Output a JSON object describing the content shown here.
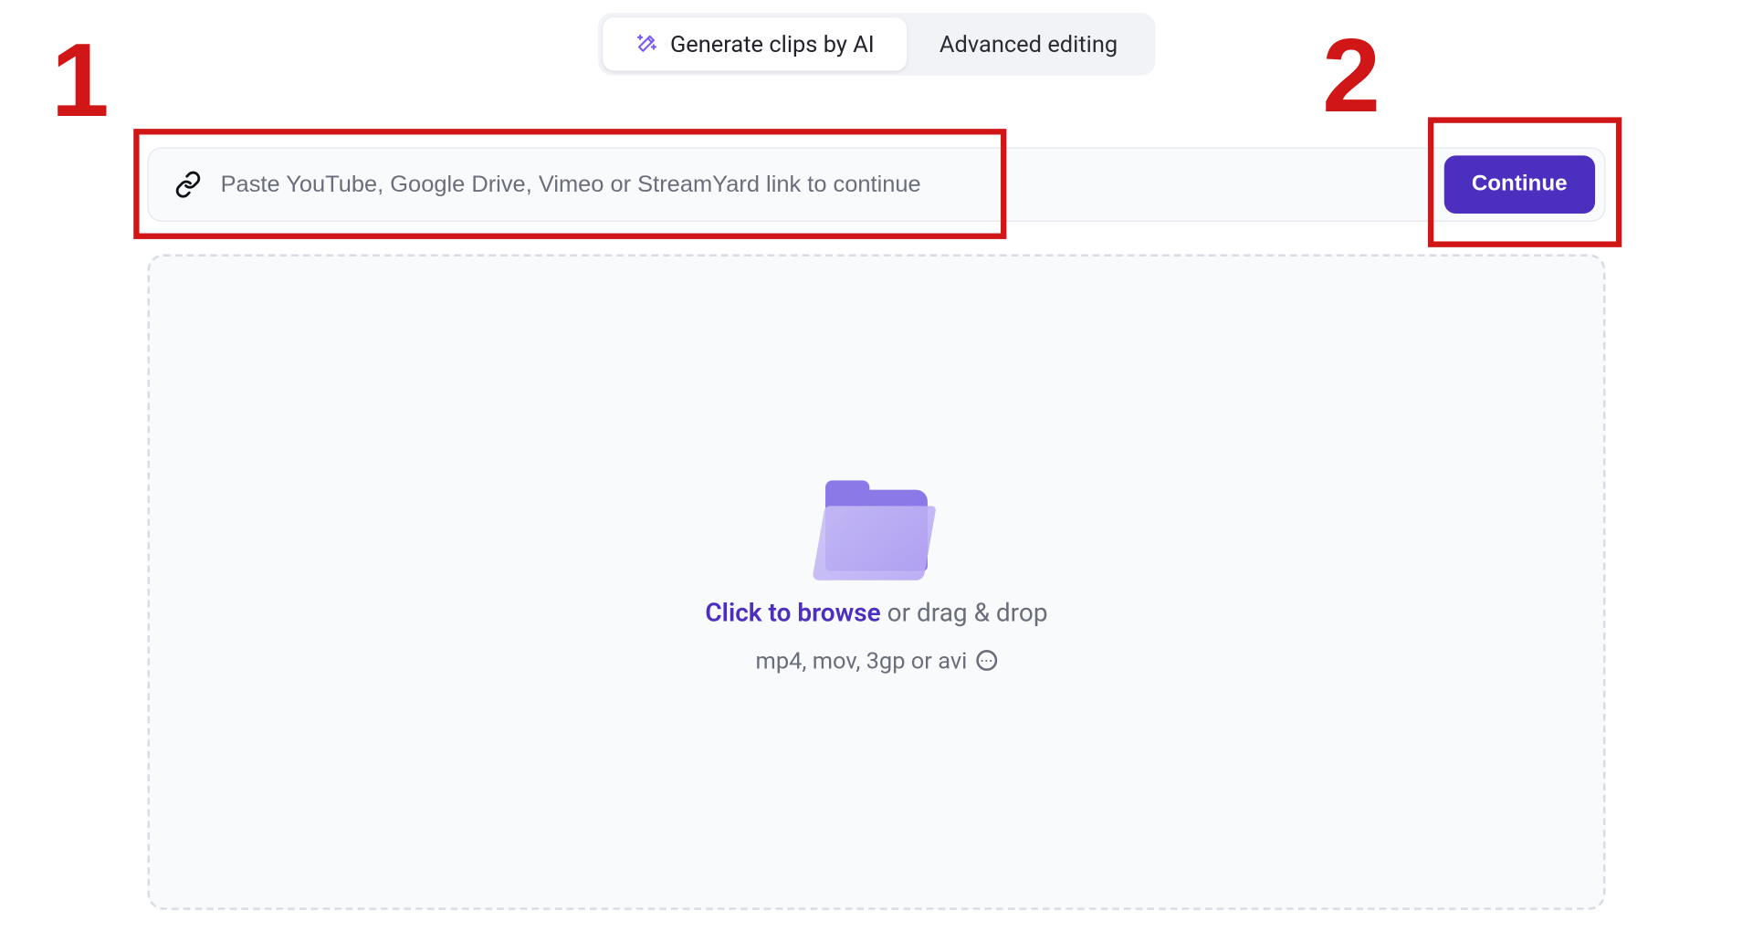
{
  "tabs": {
    "generate_label": "Generate clips by AI",
    "advanced_label": "Advanced editing"
  },
  "input_row": {
    "placeholder": "Paste YouTube, Google Drive, Vimeo or StreamYard link to continue",
    "continue_label": "Continue"
  },
  "dropzone": {
    "browse_label": "Click to browse",
    "drag_suffix": " or drag & drop",
    "formats_label": "mp4, mov, 3gp or avi"
  },
  "annotations": {
    "one": "1",
    "two": "2"
  },
  "colors": {
    "accent": "#4d2fbf",
    "annotation": "#d01616"
  }
}
